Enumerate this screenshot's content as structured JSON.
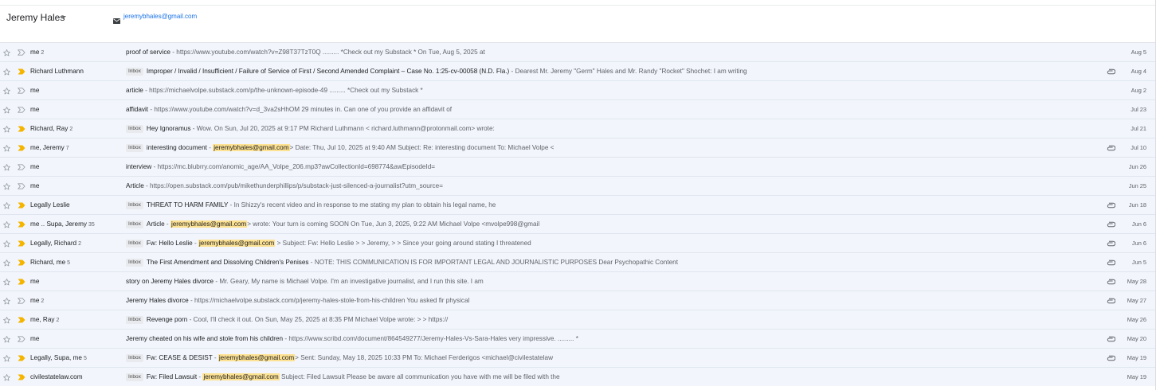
{
  "header": {
    "name": "Jeremy Hales",
    "email": "jeremybhales@gmail.com"
  },
  "labels": {
    "inbox": "Inbox"
  },
  "colors": {
    "important": "#f4b400",
    "highlight": "#fde293",
    "link": "#1a73e8",
    "row_bg": "#f2f6fc"
  },
  "rows": [
    {
      "from": "me",
      "count": "2",
      "important": false,
      "inbox": false,
      "subject": "proof of service",
      "sep": " - ",
      "pre": "https://www.youtube.com/watch?v=Z98T37TzT0Q ......... *Check out my Substack * On Tue, Aug 5, 2025 at",
      "hl": "",
      "post": "",
      "attach": false,
      "date": "Aug 5"
    },
    {
      "from": "Richard Luthmann",
      "count": "",
      "important": true,
      "inbox": true,
      "subject": "Improper / Invalid / Insufficient / Failure of Service of First / Second Amended Complaint – Case No. 1:25-cv-00058 (N.D. Fla.)",
      "sep": " - ",
      "pre": "Dearest Mr. Jeremy \"Germ\" Hales and Mr. Randy \"Rocket\" Shochet: I am writing",
      "hl": "",
      "post": "",
      "attach": true,
      "date": "Aug 4"
    },
    {
      "from": "me",
      "count": "",
      "important": false,
      "inbox": false,
      "subject": "article",
      "sep": " - ",
      "pre": "https://michaelvolpe.substack.com/p/the-unknown-episode-49 ......... *Check out my Substack *",
      "hl": "",
      "post": "",
      "attach": false,
      "date": "Aug 2"
    },
    {
      "from": "me",
      "count": "",
      "important": false,
      "inbox": false,
      "subject": "affidavit",
      "sep": " - ",
      "pre": "https://www.youtube.com/watch?v=d_3va2sHhOM 29 minutes in. Can one of you provide an affidavit of",
      "hl": "",
      "post": "",
      "attach": false,
      "date": "Jul 23"
    },
    {
      "from": "Richard, Ray",
      "count": "2",
      "important": true,
      "inbox": true,
      "subject": "Hey Ignoramus",
      "sep": " - ",
      "pre": "Wow. On Sun, Jul 20, 2025 at 9:17 PM Richard Luthmann < richard.luthmann@protonmail.com> wrote:",
      "hl": "",
      "post": "",
      "attach": false,
      "date": "Jul 21"
    },
    {
      "from": "me, Jeremy",
      "count": "7",
      "important": true,
      "inbox": true,
      "subject": "interesting document",
      "sep": " - ",
      "pre": "",
      "hl": "jeremybhales@gmail.com",
      "post": "> Date: Thu, Jul 10, 2025 at 9:40 AM Subject: Re: interesting document To: Michael Volpe <",
      "attach": true,
      "date": "Jul 10"
    },
    {
      "from": "me",
      "count": "",
      "important": false,
      "inbox": false,
      "subject": "interview",
      "sep": " - ",
      "pre": "https://mc.blubrry.com/anomic_age/AA_Volpe_206.mp3?awCollectionId=698774&awEpisodeId=",
      "hl": "",
      "post": "",
      "attach": false,
      "date": "Jun 26"
    },
    {
      "from": "me",
      "count": "",
      "important": false,
      "inbox": false,
      "subject": "Article",
      "sep": " - ",
      "pre": "https://open.substack.com/pub/mikethunderphillips/p/substack-just-silenced-a-journalist?utm_source=",
      "hl": "",
      "post": "",
      "attach": false,
      "date": "Jun 25"
    },
    {
      "from": "Legally Leslie",
      "count": "",
      "important": true,
      "inbox": true,
      "subject": "THREAT TO HARM FAMILY",
      "sep": " - ",
      "pre": "In Shizzy's recent video and in response to me stating my plan to obtain his legal name, he",
      "hl": "",
      "post": "",
      "attach": true,
      "date": "Jun 18"
    },
    {
      "from": "me .. Supa, Jeremy",
      "count": "35",
      "important": true,
      "inbox": true,
      "subject": "Article",
      "sep": " - ",
      "pre": "",
      "hl": "jeremybhales@gmail.com",
      "post": "> wrote: Your turn is coming SOON On Tue, Jun 3, 2025, 9:22 AM Michael Volpe <mvolpe998@gmail",
      "attach": true,
      "date": "Jun 6"
    },
    {
      "from": "Legally, Richard",
      "count": "2",
      "important": true,
      "inbox": true,
      "subject": "Fw: Hello Leslie",
      "sep": " - ",
      "pre": "",
      "hl": "jeremybhales@gmail.com",
      "post": " > Subject: Fw: Hello Leslie > > Jeremy, > > Since your going around stating I threatened",
      "attach": true,
      "date": "Jun 6"
    },
    {
      "from": "Richard, me",
      "count": "5",
      "important": true,
      "inbox": true,
      "subject": "The First Amendment and Dissolving Children's Penises",
      "sep": " - ",
      "pre": "NOTE: THIS COMMUNICATION IS FOR IMPORTANT LEGAL AND JOURNALISTIC PURPOSES Dear Psychopathic Content",
      "hl": "",
      "post": "",
      "attach": true,
      "date": "Jun 5"
    },
    {
      "from": "me",
      "count": "",
      "important": true,
      "inbox": false,
      "subject": "story on Jeremy Hales divorce",
      "sep": " - ",
      "pre": "Mr. Geary, My name is Michael Volpe. I'm an investigative journalist, and I run this site. I am",
      "hl": "",
      "post": "",
      "attach": true,
      "date": "May 28"
    },
    {
      "from": "me",
      "count": "2",
      "important": false,
      "inbox": false,
      "subject": "Jeremy Hales divorce",
      "sep": " - ",
      "pre": "https://michaelvolpe.substack.com/p/jeremy-hales-stole-from-his-children You asked fir physical",
      "hl": "",
      "post": "",
      "attach": true,
      "date": "May 27"
    },
    {
      "from": "me, Ray",
      "count": "2",
      "important": true,
      "inbox": true,
      "subject": "Revenge porn",
      "sep": " - ",
      "pre": "Cool, I'll check it out. On Sun, May 25, 2025 at 8:35 PM Michael Volpe wrote: > > https://",
      "hl": "",
      "post": "",
      "attach": false,
      "date": "May 26"
    },
    {
      "from": "me",
      "count": "",
      "important": false,
      "inbox": false,
      "subject": "Jeremy cheated on his wife and stole from his children",
      "sep": " - ",
      "pre": "https://www.scribd.com/document/864549277/Jeremy-Hales-Vs-Sara-Hales very impressive. ......... *",
      "hl": "",
      "post": "",
      "attach": true,
      "date": "May 20"
    },
    {
      "from": "Legally, Supa, me",
      "count": "5",
      "important": true,
      "inbox": true,
      "subject": "Fw: CEASE & DESIST",
      "sep": " - ",
      "pre": "",
      "hl": "jeremybhales@gmail.com",
      "post": "> Sent: Sunday, May 18, 2025 10:33 PM To: Michael Ferderigos <michael@civilestatelaw",
      "attach": true,
      "date": "May 19"
    },
    {
      "from": "civilestatelaw.com",
      "count": "",
      "important": true,
      "inbox": true,
      "subject": "Fw: Filed Lawsuit",
      "sep": " - ",
      "pre": "",
      "hl": "jeremybhales@gmail.com",
      "post": " Subject: Filed Lawsuit Please be aware all communication you have with me will be filed with the",
      "attach": false,
      "date": "May 19"
    }
  ]
}
